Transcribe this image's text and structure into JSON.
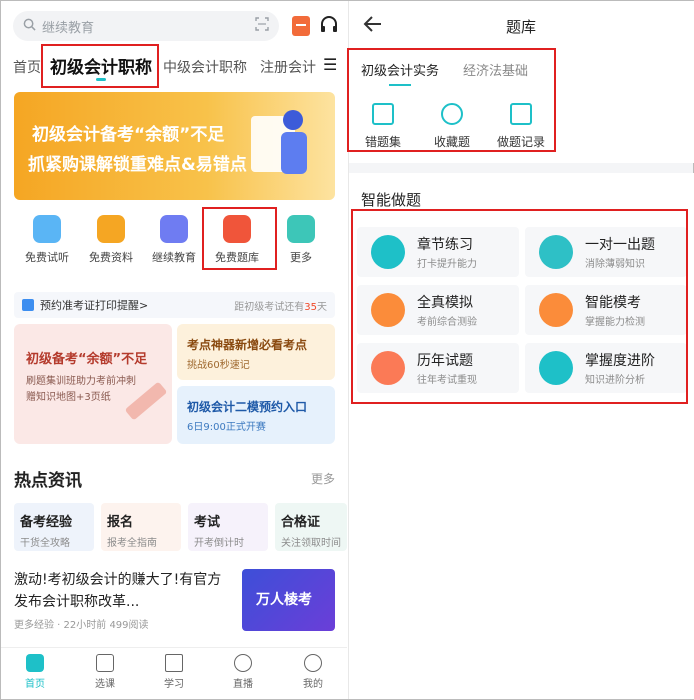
{
  "left": {
    "search": {
      "placeholder": "继续教育"
    },
    "tabs": [
      "首页",
      "初级会计职称",
      "中级会计职称",
      "注册会计"
    ],
    "banner": {
      "line1": "初级会计备考“余额”不足",
      "line2": "抓紧购课解锁重难点&易错点"
    },
    "icons": [
      {
        "label": "免费试听",
        "color": "#5ab5f5"
      },
      {
        "label": "免费资料",
        "color": "#f5a623"
      },
      {
        "label": "继续教育",
        "color": "#6f7cf2"
      },
      {
        "label": "免费题库",
        "color": "#f0553a"
      },
      {
        "label": "更多",
        "color": "#3dc6b8"
      }
    ],
    "notice": {
      "text": "预约准考证打印提醒>",
      "right_prefix": "距初级考试还有",
      "days": "35",
      "right_suffix": "天"
    },
    "promo_left": {
      "title": "初级备考“余额”不足",
      "sub1": "刷题集训班助力考前冲刺",
      "sub2": "赠知识地图+3页纸"
    },
    "promo_right_top": {
      "title": "考点神器新增必看考点",
      "sub": "挑战60秒速记"
    },
    "promo_right_bottom": {
      "title": "初级会计二模预约入口",
      "sub": "6日9:00正式开赛"
    },
    "hot": {
      "title": "热点资讯",
      "more": "更多"
    },
    "chips": [
      {
        "title": "备考经验",
        "sub": "干货全攻略",
        "bg": "#eef3fb"
      },
      {
        "title": "报名",
        "sub": "报考全指南",
        "bg": "#fdf3ee"
      },
      {
        "title": "考试",
        "sub": "开考倒计时",
        "bg": "#f6f2fb"
      },
      {
        "title": "合格证",
        "sub": "关注领取时间",
        "bg": "#eef7f4"
      }
    ],
    "news": {
      "title": "激动!考初级会计的赚大了!有官方发布会计职称改革...",
      "meta": "更多经验 · 22小时前   499阅读",
      "thumb": "万人棱考"
    },
    "nav": [
      "首页",
      "选课",
      "学习",
      "直播",
      "我的"
    ]
  },
  "right": {
    "title": "题库",
    "tabs": [
      "初级会计实务",
      "经济法基础"
    ],
    "tools": [
      "错题集",
      "收藏题",
      "做题记录"
    ],
    "section": "智能做题",
    "modes": [
      {
        "name": "章节练习",
        "sub": "打卡提升能力",
        "color": "#1ec0c8"
      },
      {
        "name": "一对一出题",
        "sub": "消除薄弱知识",
        "color": "#2ec0c6"
      },
      {
        "name": "全真模拟",
        "sub": "考前综合测验",
        "color": "#fb8c3a"
      },
      {
        "name": "智能模考",
        "sub": "掌握能力检测",
        "color": "#fb8c3a"
      },
      {
        "name": "历年试题",
        "sub": "往年考试重现",
        "color": "#fb7a56"
      },
      {
        "name": "掌握度进阶",
        "sub": "知识进阶分析",
        "color": "#1ec0c8"
      }
    ]
  }
}
